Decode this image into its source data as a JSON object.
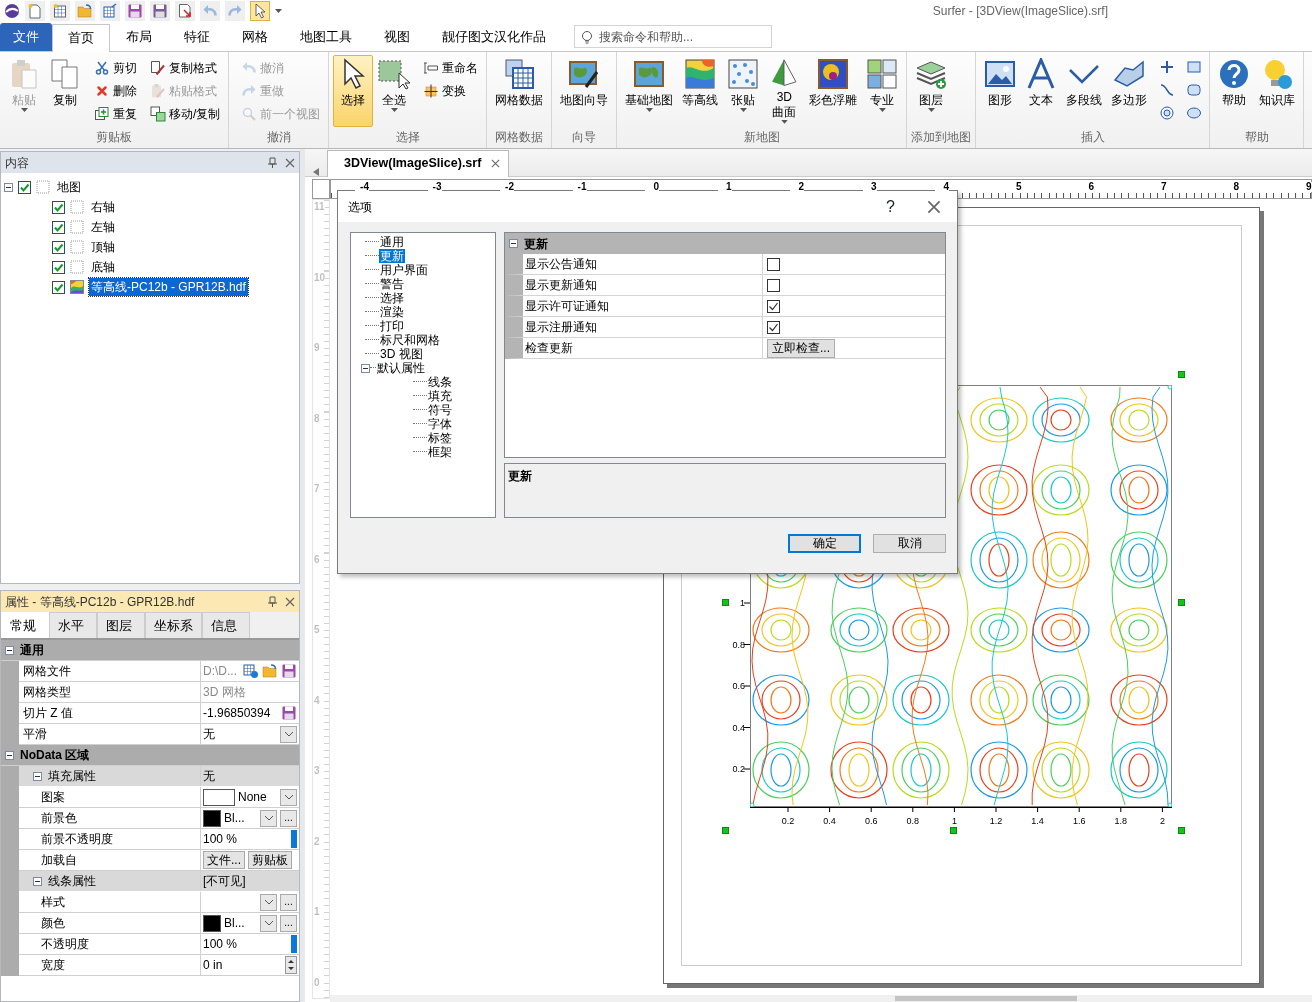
{
  "window": {
    "title": "Surfer - [3DView(ImageSlice).srf]"
  },
  "quick_access": [
    {
      "pressed": false
    },
    {
      "pressed": false
    },
    {
      "pressed": false
    },
    {
      "pressed": false
    },
    {
      "pressed": false
    },
    {
      "pressed": false
    },
    {
      "pressed": false
    },
    {
      "pressed": false
    },
    {
      "pressed": false
    },
    {
      "pressed": true
    }
  ],
  "menu_tabs": [
    {
      "label": "文件",
      "kind": "file",
      "selected": false
    },
    {
      "label": "首页",
      "kind": "tab",
      "selected": true
    },
    {
      "label": "布局",
      "kind": "tab",
      "selected": false
    },
    {
      "label": "特征",
      "kind": "tab",
      "selected": false
    },
    {
      "label": "网格",
      "kind": "tab",
      "selected": false
    },
    {
      "label": "地图工具",
      "kind": "tab",
      "selected": false
    },
    {
      "label": "视图",
      "kind": "tab",
      "selected": false
    },
    {
      "label": "靓仔图文汉化作品",
      "kind": "tab",
      "selected": false
    }
  ],
  "search": {
    "placeholder": "搜索命令和帮助..."
  },
  "ribbon": [
    {
      "label": "剪贴板",
      "items": [
        {
          "label": "粘贴",
          "kind": "large",
          "disabled": true,
          "dropdown": true,
          "pressed": false
        },
        {
          "label": "复制",
          "kind": "large",
          "disabled": false,
          "dropdown": false,
          "pressed": false
        },
        {
          "label": "剪切",
          "kind": "small",
          "disabled": false,
          "dropdown": false,
          "pressed": false
        },
        {
          "label": "删除",
          "kind": "small",
          "disabled": false,
          "dropdown": false,
          "pressed": false
        },
        {
          "label": "重复",
          "kind": "small",
          "disabled": false,
          "dropdown": false,
          "pressed": false
        },
        {
          "label": "复制格式",
          "kind": "small",
          "disabled": false,
          "dropdown": false,
          "pressed": false
        },
        {
          "label": "粘贴格式",
          "kind": "small",
          "disabled": true,
          "dropdown": false,
          "pressed": false
        },
        {
          "label": "移动/复制",
          "kind": "small",
          "disabled": false,
          "dropdown": false,
          "pressed": false
        }
      ]
    },
    {
      "label": "撤消",
      "items": [
        {
          "label": "撤消",
          "kind": "small",
          "disabled": true,
          "dropdown": false,
          "pressed": false
        },
        {
          "label": "重做",
          "kind": "small",
          "disabled": true,
          "dropdown": false,
          "pressed": false
        },
        {
          "label": "前一个视图",
          "kind": "small",
          "disabled": true,
          "dropdown": false,
          "pressed": false
        }
      ]
    },
    {
      "label": "选择",
      "items": [
        {
          "label": "选择",
          "kind": "large",
          "disabled": false,
          "dropdown": false,
          "pressed": true
        },
        {
          "label": "全选",
          "kind": "large",
          "disabled": false,
          "dropdown": true,
          "pressed": false
        },
        {
          "label": "重命名",
          "kind": "small",
          "disabled": false,
          "dropdown": false,
          "pressed": false
        },
        {
          "label": "变换",
          "kind": "small",
          "disabled": false,
          "dropdown": false,
          "pressed": false
        }
      ]
    },
    {
      "label": "网格数据",
      "items": [
        {
          "label": "网格数据",
          "kind": "large",
          "disabled": false,
          "dropdown": false,
          "pressed": false
        }
      ]
    },
    {
      "label": "向导",
      "items": [
        {
          "label": "地图向导",
          "kind": "large",
          "disabled": false,
          "dropdown": false,
          "pressed": false
        }
      ]
    },
    {
      "label": "新地图",
      "items": [
        {
          "label": "基础地图",
          "kind": "large",
          "disabled": false,
          "dropdown": true,
          "pressed": false
        },
        {
          "label": "等高线",
          "kind": "large",
          "disabled": false,
          "dropdown": false,
          "pressed": false
        },
        {
          "label": "张贴",
          "kind": "large",
          "disabled": false,
          "dropdown": true,
          "pressed": false
        },
        {
          "label": "3D\n曲面",
          "kind": "large",
          "disabled": false,
          "dropdown": true,
          "pressed": false
        },
        {
          "label": "彩色浮雕",
          "kind": "large",
          "disabled": false,
          "dropdown": false,
          "pressed": false
        },
        {
          "label": "专业",
          "kind": "large",
          "disabled": false,
          "dropdown": true,
          "pressed": false
        }
      ]
    },
    {
      "label": "添加到地图",
      "items": [
        {
          "label": "图层",
          "kind": "large",
          "disabled": false,
          "dropdown": true,
          "pressed": false
        }
      ]
    },
    {
      "label": "插入",
      "items": [
        {
          "label": "图形",
          "kind": "large",
          "disabled": false,
          "dropdown": false,
          "pressed": false
        },
        {
          "label": "文本",
          "kind": "large",
          "disabled": false,
          "dropdown": false,
          "pressed": false
        },
        {
          "label": "多段线",
          "kind": "large",
          "disabled": false,
          "dropdown": false,
          "pressed": false
        },
        {
          "label": "多边形",
          "kind": "large",
          "disabled": false,
          "dropdown": false,
          "pressed": false
        },
        {
          "kind": "tool",
          "disabled": false,
          "dropdown": false,
          "pressed": false
        },
        {
          "kind": "tool",
          "disabled": false,
          "dropdown": false,
          "pressed": false
        },
        {
          "kind": "tool",
          "disabled": false,
          "dropdown": false,
          "pressed": false
        },
        {
          "kind": "tool",
          "disabled": false,
          "dropdown": false,
          "pressed": false
        },
        {
          "kind": "tool",
          "disabled": false,
          "dropdown": false,
          "pressed": false
        },
        {
          "kind": "tool",
          "disabled": false,
          "dropdown": false,
          "pressed": false
        }
      ]
    },
    {
      "label": "帮助",
      "items": [
        {
          "label": "帮助",
          "kind": "large",
          "disabled": false,
          "dropdown": false,
          "pressed": false
        },
        {
          "label": "知识库",
          "kind": "large",
          "disabled": false,
          "dropdown": false,
          "pressed": false
        }
      ]
    }
  ],
  "contents_panel": {
    "title": "内容",
    "tree": [
      {
        "label": "地图",
        "kind": "map",
        "checked": true,
        "selected": false,
        "expanded": true,
        "children": [
          {
            "label": "右轴",
            "kind": "axis",
            "checked": true,
            "selected": false
          },
          {
            "label": "左轴",
            "kind": "axis",
            "checked": true,
            "selected": false
          },
          {
            "label": "顶轴",
            "kind": "axis",
            "checked": true,
            "selected": false
          },
          {
            "label": "底轴",
            "kind": "axis",
            "checked": true,
            "selected": false
          },
          {
            "label": "等高线-PC12b - GPR12B.hdf",
            "kind": "contour",
            "checked": true,
            "selected": true
          }
        ]
      }
    ]
  },
  "properties_panel": {
    "title": "属性 - 等高线-PC12b - GPR12B.hdf",
    "tabs": [
      {
        "label": "常规",
        "selected": true
      },
      {
        "label": "水平",
        "selected": false
      },
      {
        "label": "图层",
        "selected": false
      },
      {
        "label": "坐标系",
        "selected": false
      },
      {
        "label": "信息",
        "selected": false
      }
    ],
    "sections": [
      {
        "label": "通用",
        "expanded": true,
        "items": [
          {
            "name": "网格文件",
            "kind": "file",
            "value": "D:\\D...",
            "readonly": true
          },
          {
            "name": "网格类型",
            "kind": "text",
            "value": "3D 网格",
            "readonly": true
          },
          {
            "name": "切片 Z 值",
            "kind": "save",
            "value": "-1.96850394",
            "readonly": false
          },
          {
            "name": "平滑",
            "kind": "dropdown",
            "value": "无",
            "readonly": false
          }
        ]
      },
      {
        "label": "NoData 区域",
        "expanded": true,
        "items": [
          {
            "name": "填充属性",
            "kind": "group",
            "value": "无",
            "expanded": true,
            "rows": [
              {
                "name": "图案",
                "kind": "pattern",
                "value": "None",
                "color": "#ffffff",
                "readonly": false
              },
              {
                "name": "前景色",
                "kind": "color",
                "value": "Bl...",
                "color": "#000000",
                "more_button": "...",
                "readonly": false
              },
              {
                "name": "前景不透明度",
                "kind": "opacity",
                "value": "100 %",
                "level": 1,
                "readonly": false
              },
              {
                "name": "加载自",
                "kind": "buttons",
                "buttons": [
                  "文件...",
                  "剪贴板"
                ],
                "readonly": false
              }
            ]
          },
          {
            "name": "线条属性",
            "kind": "group",
            "value": "[不可见]",
            "expanded": true,
            "rows": [
              {
                "name": "样式",
                "kind": "dropdown",
                "more_button": "...",
                "readonly": false
              },
              {
                "name": "颜色",
                "kind": "color",
                "value": "Bl...",
                "color": "#000000",
                "more_button": "...",
                "readonly": false
              },
              {
                "name": "不透明度",
                "kind": "opacity",
                "value": "100 %",
                "level": 1,
                "readonly": false
              },
              {
                "name": "宽度",
                "kind": "spinner",
                "value": "0 in",
                "readonly": false
              }
            ]
          }
        ]
      }
    ]
  },
  "document": {
    "tab": "3DView(ImageSlice).srf",
    "rulers": {
      "horizontal": [
        "-4",
        "-3",
        "-2",
        "-1",
        "0",
        "1",
        "2",
        "3",
        "4",
        "5",
        "6",
        "7",
        "8",
        "9"
      ],
      "vertical": [
        "11",
        "10",
        "9",
        "8",
        "7",
        "6",
        "5",
        "4",
        "3",
        "2",
        "1",
        "0"
      ]
    },
    "plot": {
      "x_ticks": [
        "0.2",
        "0.4",
        "0.6",
        "0.8",
        "1",
        "1.2",
        "1.4",
        "1.6",
        "1.8",
        "2"
      ],
      "y_ticks": [
        "1",
        "0.8",
        "0.6",
        "0.4",
        "0.2"
      ]
    }
  },
  "options_dialog": {
    "title": "选项",
    "help": "?",
    "tree": [
      {
        "label": "通用",
        "selected": false
      },
      {
        "label": "更新",
        "selected": true
      },
      {
        "label": "用户界面",
        "selected": false
      },
      {
        "label": "警告",
        "selected": false
      },
      {
        "label": "选择",
        "selected": false
      },
      {
        "label": "渲染",
        "selected": false
      },
      {
        "label": "打印",
        "selected": false
      },
      {
        "label": "标尺和网格",
        "selected": false
      },
      {
        "label": "3D 视图",
        "selected": false
      },
      {
        "label": "默认属性",
        "selected": false,
        "expanded": true,
        "children": [
          {
            "label": "线条",
            "selected": false
          },
          {
            "label": "填充",
            "selected": false
          },
          {
            "label": "符号",
            "selected": false
          },
          {
            "label": "字体",
            "selected": false
          },
          {
            "label": "标签",
            "selected": false
          },
          {
            "label": "框架",
            "selected": false
          }
        ]
      }
    ],
    "grid": {
      "section": "更新",
      "expanded": true,
      "rows": [
        {
          "name": "显示公告通知",
          "kind": "checkbox",
          "checked": false
        },
        {
          "name": "显示更新通知",
          "kind": "checkbox",
          "checked": false
        },
        {
          "name": "显示许可证通知",
          "kind": "checkbox",
          "checked": true
        },
        {
          "name": "显示注册通知",
          "kind": "checkbox",
          "checked": true
        },
        {
          "name": "检查更新",
          "kind": "button",
          "button": "立即检查..."
        }
      ]
    },
    "description": {
      "title": "更新"
    },
    "buttons": [
      {
        "label": "确定",
        "default": true
      },
      {
        "label": "取消",
        "default": false
      }
    ]
  }
}
